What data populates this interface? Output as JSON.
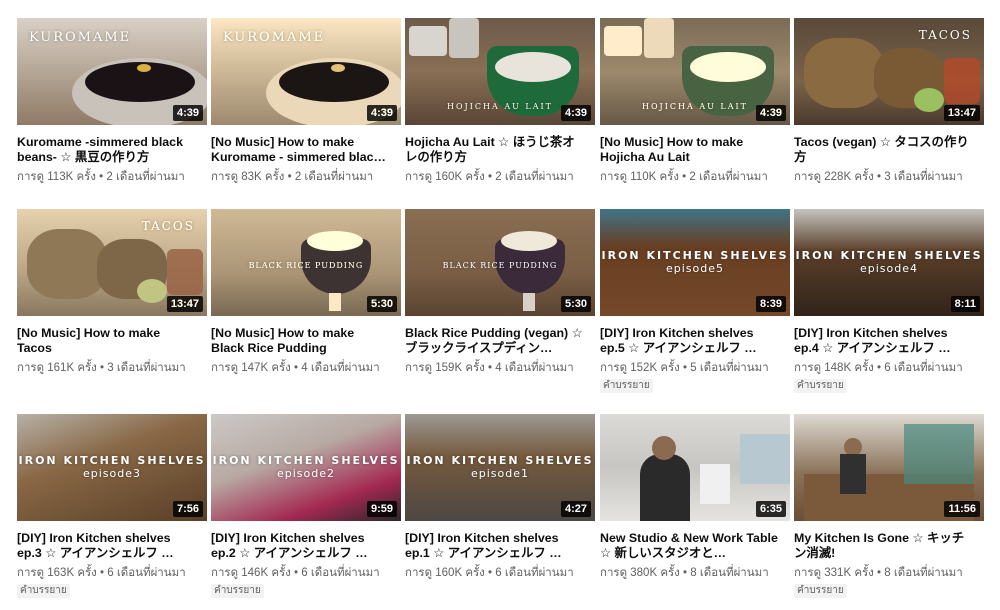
{
  "more_icon": "ellipsis-icon",
  "videos": [
    {
      "title": "Kuromame -simmered black beans- ☆ 黒豆の作り方",
      "views": "การดู 113K ครั้ง",
      "age": "2 เดือนที่ผ่านมา",
      "duration": "4:39",
      "watermark": "KUROMAME",
      "subtitles": "",
      "theme": "kuromame-color"
    },
    {
      "title": "[No Music] How to make Kuromame - simmered blac…",
      "views": "การดู 83K ครั้ง",
      "age": "2 เดือนที่ผ่านมา",
      "duration": "4:39",
      "watermark": "KUROMAME",
      "subtitles": "",
      "theme": "kuromame-sepia"
    },
    {
      "title": "Hojicha Au Lait ☆ ほうじ茶オレの作り方",
      "views": "การดู 160K ครั้ง",
      "age": "2 เดือนที่ผ่านมา",
      "duration": "4:39",
      "watermark": "HOJICHA AU LAIT",
      "subtitles": "",
      "theme": "hojicha-color"
    },
    {
      "title": "[No Music] How to make Hojicha Au Lait",
      "views": "การดู 110K ครั้ง",
      "age": "2 เดือนที่ผ่านมา",
      "duration": "4:39",
      "watermark": "HOJICHA AU LAIT",
      "subtitles": "",
      "theme": "hojicha-sepia"
    },
    {
      "title": "Tacos (vegan) ☆ タコスの作り方",
      "views": "การดู 228K ครั้ง",
      "age": "3 เดือนที่ผ่านมา",
      "duration": "13:47",
      "watermark": "TACOS",
      "subtitles": "",
      "theme": "tacos-color"
    },
    {
      "title": "[No Music] How to make Tacos",
      "views": "การดู 161K ครั้ง",
      "age": "3 เดือนที่ผ่านมา",
      "duration": "13:47",
      "watermark": "TACOS",
      "subtitles": "",
      "theme": "tacos-sepia"
    },
    {
      "title": "[No Music] How to make Black Rice Pudding",
      "views": "การดู 147K ครั้ง",
      "age": "4 เดือนที่ผ่านมา",
      "duration": "5:30",
      "watermark": "BLACK RICE PUDDING",
      "subtitles": "",
      "theme": "pudding-sepia"
    },
    {
      "title": "Black Rice Pudding (vegan) ☆ ブラックライスプディン…",
      "views": "การดู 159K ครั้ง",
      "age": "4 เดือนที่ผ่านมา",
      "duration": "5:30",
      "watermark": "BLACK RICE PUDDING",
      "subtitles": "",
      "theme": "pudding-color"
    },
    {
      "title": "[DIY] Iron Kitchen shelves ep.5 ☆ アイアンシェルフ …",
      "views": "การดู 152K ครั้ง",
      "age": "5 เดือนที่ผ่านมา",
      "duration": "8:39",
      "watermark": "IRON KITCHEN SHELVES",
      "episode": "episode5",
      "subtitles": "คำบรรยาย",
      "theme": "iron-ep5"
    },
    {
      "title": "[DIY] Iron Kitchen shelves ep.4 ☆ アイアンシェルフ …",
      "views": "การดู 148K ครั้ง",
      "age": "6 เดือนที่ผ่านมา",
      "duration": "8:11",
      "watermark": "IRON KITCHEN SHELVES",
      "episode": "episode4",
      "subtitles": "คำบรรยาย",
      "theme": "iron-ep4"
    },
    {
      "title": "[DIY] Iron Kitchen shelves ep.3 ☆ アイアンシェルフ …",
      "views": "การดู 163K ครั้ง",
      "age": "6 เดือนที่ผ่านมา",
      "duration": "7:56",
      "watermark": "IRON KITCHEN SHELVES",
      "episode": "episode3",
      "subtitles": "คำบรรยาย",
      "theme": "iron-ep3"
    },
    {
      "title": "[DIY] Iron Kitchen shelves ep.2 ☆ アイアンシェルフ …",
      "views": "การดู 146K ครั้ง",
      "age": "6 เดือนที่ผ่านมา",
      "duration": "9:59",
      "watermark": "IRON KITCHEN SHELVES",
      "episode": "episode2",
      "subtitles": "คำบรรยาย",
      "theme": "iron-ep2"
    },
    {
      "title": "[DIY] Iron Kitchen shelves ep.1 ☆ アイアンシェルフ …",
      "views": "การดู 160K ครั้ง",
      "age": "6 เดือนที่ผ่านมา",
      "duration": "4:27",
      "watermark": "IRON KITCHEN SHELVES",
      "episode": "episode1",
      "subtitles": "",
      "theme": "iron-ep1"
    },
    {
      "title": "New Studio & New Work Table ☆ 新しいスタジオと…",
      "views": "การดู 380K ครั้ง",
      "age": "8 เดือนที่ผ่านมา",
      "duration": "6:35",
      "watermark": "",
      "subtitles": "",
      "theme": "studio"
    },
    {
      "title": "My Kitchen Is Gone ☆ キッチン消滅!",
      "views": "การดู 331K ครั้ง",
      "age": "8 เดือนที่ผ่านมา",
      "duration": "11:56",
      "watermark": "",
      "subtitles": "คำบรรยาย",
      "theme": "kitchen-gone"
    }
  ]
}
